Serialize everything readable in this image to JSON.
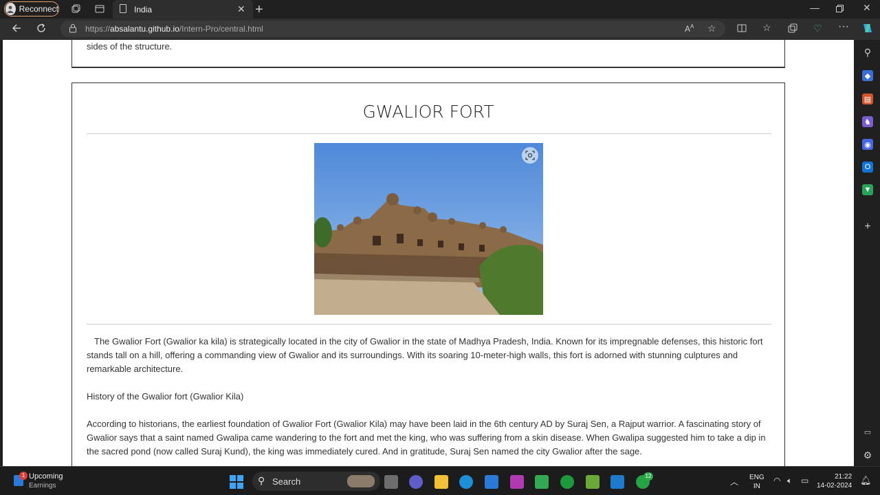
{
  "browser": {
    "profile_button": "Reconnect",
    "tab_title": "India",
    "url_prefix": "https://",
    "url_host": "absalantu.github.io",
    "url_path": "/Intern-Pro/central.html"
  },
  "page": {
    "previous_card_tail": "sides of the structure.",
    "heading": "GWALIOR FORT",
    "paragraph_intro": "The Gwalior Fort (Gwalior ka kila) is strategically located in the city of Gwalior in the state of Madhya Pradesh, India. Known for its impregnable defenses, this historic fort stands tall on a hill, offering a commanding view of Gwalior and its surroundings. With its soaring 10-meter-high walls, this fort is adorned with stunning culptures and remarkable architecture.",
    "history_title": "History of the Gwalior fort (Gwalior Kila)",
    "paragraph_history": "According to historians, the earliest foundation of Gwalior Fort (Gwalior Kila) may have been laid in the 6th century AD by Suraj Sen, a Rajput warrior. A fascinating story of Gwalior says that a saint named Gwalipa came wandering to the fort and met the king, who was suffering from a skin disease. When Gwalipa suggested him to take a dip in the sacred pond (now called Suraj Kund), the king was immediately cured. And in gratitude, Suraj Sen named the city Gwalior after the sage."
  },
  "taskbar": {
    "weather_badge": "1",
    "weather_title": "Upcoming",
    "weather_sub": "Earnings",
    "search_label": "Search",
    "whatsapp_badge": "12",
    "lang_top": "ENG",
    "lang_bottom": "IN",
    "time": "21:22",
    "date": "14-02-2024"
  }
}
